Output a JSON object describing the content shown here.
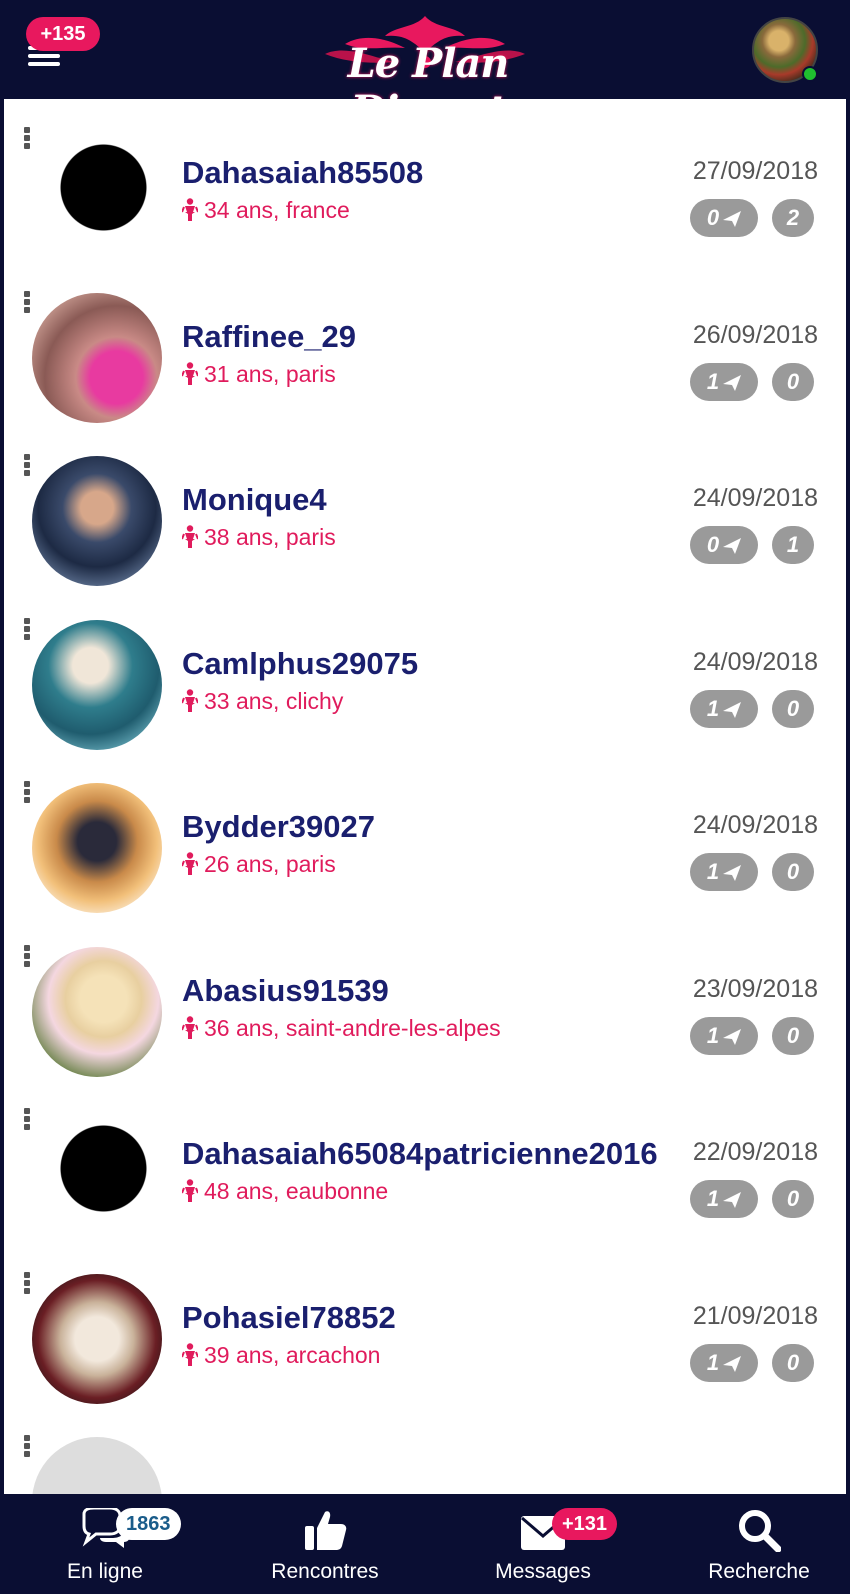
{
  "header": {
    "notif_count": "+135",
    "logo": "Le Plan Discret"
  },
  "profiles": [
    {
      "name": "Dahasaiah85508",
      "details": "34 ans, france",
      "date": "27/09/2018",
      "messages": "0",
      "count": "2",
      "photo": "silhouette"
    },
    {
      "name": "Raffinee_29",
      "details": "31 ans, paris",
      "date": "26/09/2018",
      "messages": "1",
      "count": "0",
      "photo": "pink"
    },
    {
      "name": "Monique4",
      "details": "38 ans, paris",
      "date": "24/09/2018",
      "messages": "0",
      "count": "1",
      "photo": "dark"
    },
    {
      "name": "Camlphus29075",
      "details": "33 ans, clichy",
      "date": "24/09/2018",
      "messages": "1",
      "count": "0",
      "photo": "teal"
    },
    {
      "name": "Bydder39027",
      "details": "26 ans, paris",
      "date": "24/09/2018",
      "messages": "1",
      "count": "0",
      "photo": "warm"
    },
    {
      "name": "Abasius91539",
      "details": "36 ans, saint-andre-les-alpes",
      "date": "23/09/2018",
      "messages": "1",
      "count": "0",
      "photo": "blonde"
    },
    {
      "name": "Dahasaiah65084patricienne2016",
      "details": "48 ans, eaubonne",
      "date": "22/09/2018",
      "messages": "1",
      "count": "0",
      "photo": "silhouette"
    },
    {
      "name": "Pohasiel78852",
      "details": "39 ans, arcachon",
      "date": "21/09/2018",
      "messages": "1",
      "count": "0",
      "photo": "room"
    }
  ],
  "nav": {
    "online": {
      "label": "En ligne",
      "badge": "1863"
    },
    "meetings": {
      "label": "Rencontres"
    },
    "messages": {
      "label": "Messages",
      "badge": "+131"
    },
    "search": {
      "label": "Recherche"
    }
  },
  "colors": {
    "navy": "#0a0e33",
    "accent": "#e8185e",
    "name": "#1a1f6e",
    "pill": "#9a9a9a"
  }
}
